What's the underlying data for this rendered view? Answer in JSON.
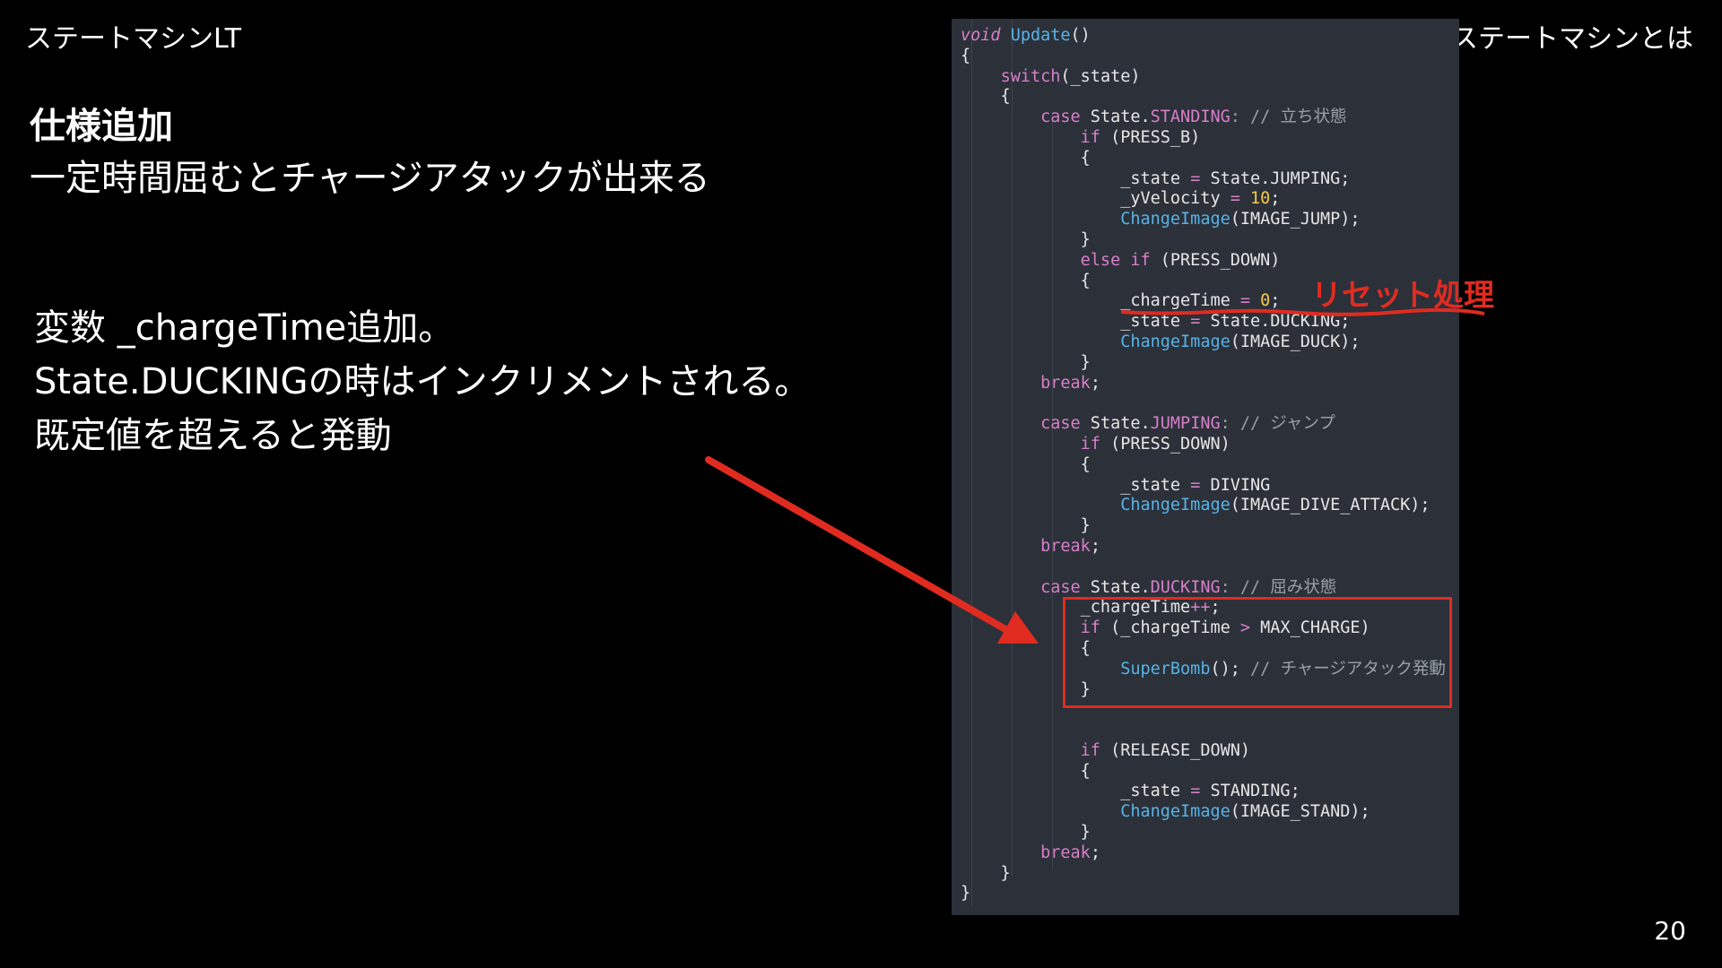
{
  "header": {
    "left_title": "ステートマシンLT",
    "right_title": "ステートマシンとは"
  },
  "spec": {
    "title": "仕様追加",
    "description": "一定時間屈むとチャージアタックが出来る"
  },
  "body_lines": [
    "変数 _chargeTime追加。",
    "State.DUCKINGの時はインクリメントされる。",
    "既定値を超えると発動"
  ],
  "annotation": {
    "reset_label": "リセット処理"
  },
  "page_number": "20",
  "colors": {
    "accent_red": "#e02b20",
    "code_bg": "#2b3039"
  },
  "code_lines": [
    [
      {
        "t": "void",
        "c": "ty"
      },
      {
        "t": " "
      },
      {
        "t": "Update",
        "c": "fn"
      },
      {
        "t": "()"
      }
    ],
    [
      {
        "t": "{"
      }
    ],
    [
      {
        "t": "    "
      },
      {
        "t": "switch",
        "c": "kw"
      },
      {
        "t": "(_state)"
      }
    ],
    [
      {
        "t": "    {"
      }
    ],
    [
      {
        "t": "        "
      },
      {
        "t": "case",
        "c": "kw"
      },
      {
        "t": " State."
      },
      {
        "t": "STANDING",
        "c": "cst"
      },
      {
        "t": ": // 立ち状態",
        "c": "cm"
      }
    ],
    [
      {
        "t": "            "
      },
      {
        "t": "if",
        "c": "kw"
      },
      {
        "t": " (PRESS_B)"
      }
    ],
    [
      {
        "t": "            {"
      }
    ],
    [
      {
        "t": "                _state "
      },
      {
        "t": "=",
        "c": "op"
      },
      {
        "t": " State.JUMPING;"
      }
    ],
    [
      {
        "t": "                _yVelocity "
      },
      {
        "t": "=",
        "c": "op"
      },
      {
        "t": " "
      },
      {
        "t": "10",
        "c": "num"
      },
      {
        "t": ";"
      }
    ],
    [
      {
        "t": "                "
      },
      {
        "t": "ChangeImage",
        "c": "fn"
      },
      {
        "t": "(IMAGE_JUMP);"
      }
    ],
    [
      {
        "t": "            }"
      }
    ],
    [
      {
        "t": "            "
      },
      {
        "t": "else if",
        "c": "kw"
      },
      {
        "t": " (PRESS_DOWN)"
      }
    ],
    [
      {
        "t": "            {"
      }
    ],
    [
      {
        "t": "                _chargeTime "
      },
      {
        "t": "=",
        "c": "op"
      },
      {
        "t": " "
      },
      {
        "t": "0",
        "c": "num"
      },
      {
        "t": ";"
      }
    ],
    [
      {
        "t": "                _state "
      },
      {
        "t": "=",
        "c": "op"
      },
      {
        "t": " State.DUCKING;"
      }
    ],
    [
      {
        "t": "                "
      },
      {
        "t": "ChangeImage",
        "c": "fn"
      },
      {
        "t": "(IMAGE_DUCK);"
      }
    ],
    [
      {
        "t": "            }"
      }
    ],
    [
      {
        "t": "        "
      },
      {
        "t": "break",
        "c": "kw"
      },
      {
        "t": ";"
      }
    ],
    [
      {
        "t": ""
      }
    ],
    [
      {
        "t": "        "
      },
      {
        "t": "case",
        "c": "kw"
      },
      {
        "t": " State."
      },
      {
        "t": "JUMPING",
        "c": "cst"
      },
      {
        "t": ": // ジャンプ",
        "c": "cm"
      }
    ],
    [
      {
        "t": "            "
      },
      {
        "t": "if",
        "c": "kw"
      },
      {
        "t": " (PRESS_DOWN)"
      }
    ],
    [
      {
        "t": "            {"
      }
    ],
    [
      {
        "t": "                _state "
      },
      {
        "t": "=",
        "c": "op"
      },
      {
        "t": " DIVING"
      }
    ],
    [
      {
        "t": "                "
      },
      {
        "t": "ChangeImage",
        "c": "fn"
      },
      {
        "t": "(IMAGE_DIVE_ATTACK);"
      }
    ],
    [
      {
        "t": "            }"
      }
    ],
    [
      {
        "t": "        "
      },
      {
        "t": "break",
        "c": "kw"
      },
      {
        "t": ";"
      }
    ],
    [
      {
        "t": ""
      }
    ],
    [
      {
        "t": "        "
      },
      {
        "t": "case",
        "c": "kw"
      },
      {
        "t": " State."
      },
      {
        "t": "DUCKING",
        "c": "cst"
      },
      {
        "t": ": // 屈み状態",
        "c": "cm"
      }
    ],
    [
      {
        "t": "            _chargeTime"
      },
      {
        "t": "++",
        "c": "op"
      },
      {
        "t": ";"
      }
    ],
    [
      {
        "t": "            "
      },
      {
        "t": "if",
        "c": "kw"
      },
      {
        "t": " (_chargeTime "
      },
      {
        "t": ">",
        "c": "op"
      },
      {
        "t": " MAX_CHARGE)"
      }
    ],
    [
      {
        "t": "            {"
      }
    ],
    [
      {
        "t": "                "
      },
      {
        "t": "SuperBomb",
        "c": "fn"
      },
      {
        "t": "(); "
      },
      {
        "t": "// チャージアタック発動",
        "c": "cm"
      }
    ],
    [
      {
        "t": "            }"
      }
    ],
    [
      {
        "t": ""
      }
    ],
    [
      {
        "t": ""
      }
    ],
    [
      {
        "t": "            "
      },
      {
        "t": "if",
        "c": "kw"
      },
      {
        "t": " (RELEASE_DOWN)"
      }
    ],
    [
      {
        "t": "            {"
      }
    ],
    [
      {
        "t": "                _state "
      },
      {
        "t": "=",
        "c": "op"
      },
      {
        "t": " STANDING;"
      }
    ],
    [
      {
        "t": "                "
      },
      {
        "t": "ChangeImage",
        "c": "fn"
      },
      {
        "t": "(IMAGE_STAND);"
      }
    ],
    [
      {
        "t": "            }"
      }
    ],
    [
      {
        "t": "        "
      },
      {
        "t": "break",
        "c": "kw"
      },
      {
        "t": ";"
      }
    ],
    [
      {
        "t": "    }"
      }
    ],
    [
      {
        "t": "}"
      }
    ]
  ]
}
